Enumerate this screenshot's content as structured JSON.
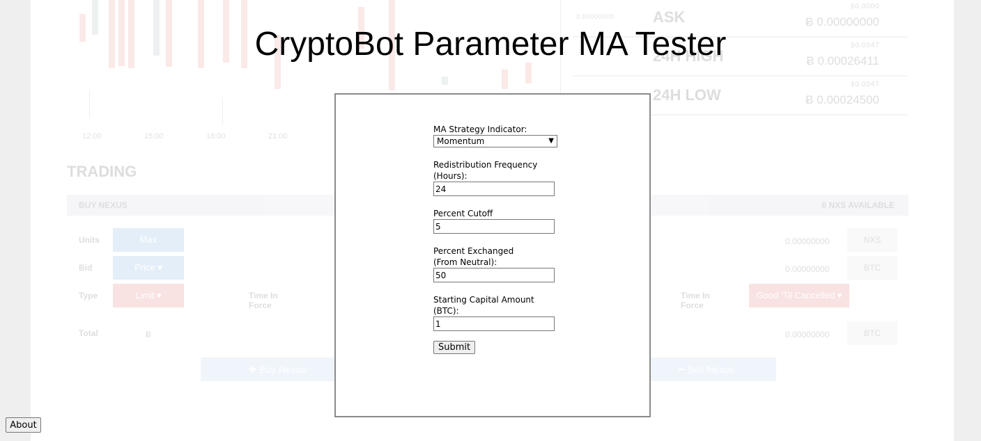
{
  "title": "CryptoBot Parameter MA Tester",
  "form": {
    "indicator_label": "MA Strategy Indicator:",
    "indicator_value": "Momentum",
    "frequency_label_1": "Redistribution Frequency",
    "frequency_label_2": "(Hours):",
    "frequency_value": "24",
    "cutoff_label": "Percent Cutoff",
    "cutoff_value": "5",
    "exchanged_label_1": "Percent Exchanged",
    "exchanged_label_2": "(From Neutral):",
    "exchanged_value": "50",
    "capital_label_1": "Starting Capital Amount",
    "capital_label_2": "(BTC):",
    "capital_value": "1",
    "submit_label": "Submit"
  },
  "about_label": "About",
  "background": {
    "stats": [
      {
        "label": "ASK",
        "value": "Ƀ 0.00000000",
        "small": "$0.0000",
        "tiny": "0.00000000"
      },
      {
        "label": "24H HIGH",
        "value": "Ƀ 0.00026411",
        "small": "$0.0047",
        "tiny": ""
      },
      {
        "label": "24H LOW",
        "value": "Ƀ 0.00024500",
        "small": "$0.0047",
        "tiny": ""
      }
    ],
    "axis": [
      "12:00",
      "15:00",
      "18:00",
      "21:00"
    ],
    "heading": "TRADING",
    "buy_bar": "BUY NEXUS",
    "available": "0 NXS AVAILABLE",
    "units": "Units",
    "bid": "Bid",
    "type": "Type",
    "total": "Total",
    "max": "Max",
    "price": "Price ▾",
    "limit": "Limit ▾",
    "time_in_force": "Time In Force",
    "gtc": "Good 'Til Cancelled ▾",
    "zero": "0.00000000",
    "nxs": "NXS",
    "btc": "BTC",
    "bitcoin_sign": "Ƀ",
    "buy_btn": "✚ Buy Nexus",
    "sell_btn": "━ Sell Nexus"
  }
}
